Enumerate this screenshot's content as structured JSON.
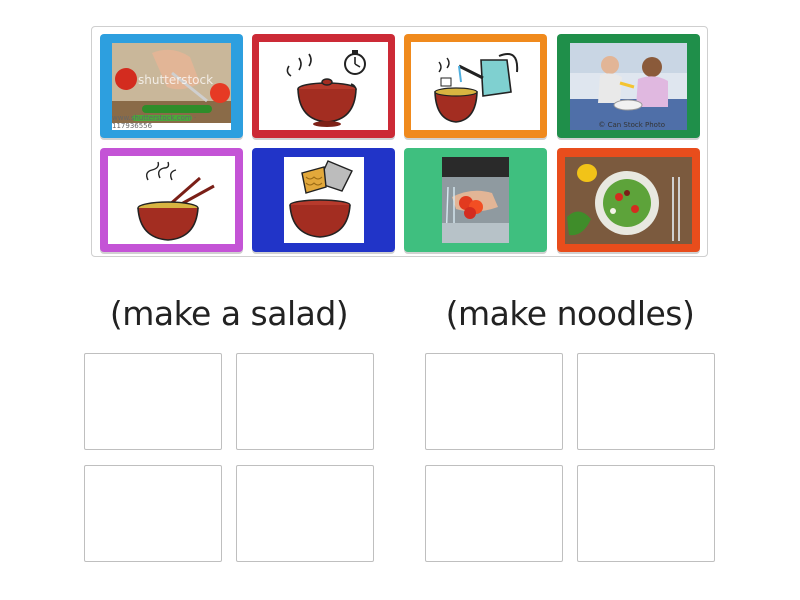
{
  "cards": [
    {
      "name": "card-cutting-vegetables",
      "border": "#2d9fdf",
      "watermark": "shutterstock",
      "credit": "www.shutterstock.com · 117936556"
    },
    {
      "name": "card-cook-with-timer",
      "border": "#cc2a36"
    },
    {
      "name": "card-pour-water-noodles",
      "border": "#f08a1d"
    },
    {
      "name": "card-girls-cooking",
      "border": "#1f8f4a",
      "credit": "© Can Stock Photo"
    },
    {
      "name": "card-eat-noodles",
      "border": "#c454d6"
    },
    {
      "name": "card-add-noodles-to-bowl",
      "border": "#2134c8"
    },
    {
      "name": "card-wash-tomatoes",
      "border": "#3fbf7f"
    },
    {
      "name": "card-salad-plate",
      "border": "#e84d1c"
    }
  ],
  "groups": {
    "left_title": "(make a salad)",
    "right_title": "(make noodles)"
  }
}
